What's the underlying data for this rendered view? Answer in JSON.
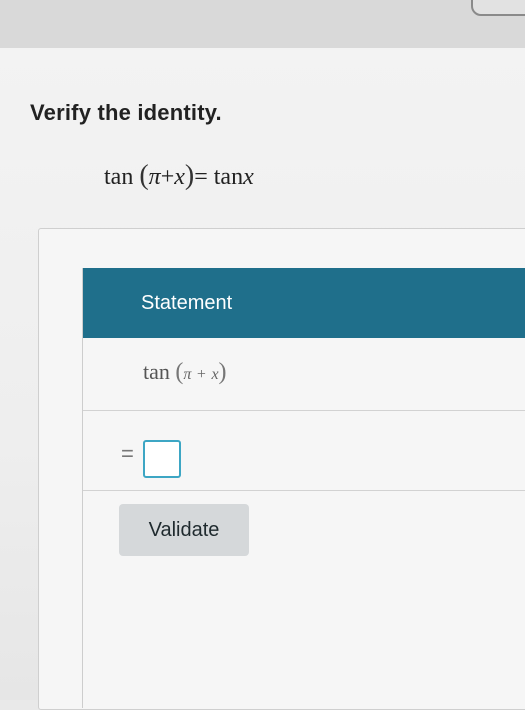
{
  "instruction": "Verify the identity.",
  "identity": {
    "lhs_func": "tan",
    "lhs_arg_left": "π",
    "lhs_arg_op": "+",
    "lhs_arg_right": "x",
    "equals": "=",
    "rhs_func": "tan",
    "rhs_var": "x"
  },
  "table": {
    "header_label": "Statement",
    "row1": {
      "func": "tan",
      "arg_left": "π",
      "arg_op": "+",
      "arg_right": "x"
    },
    "row2": {
      "equals": "=",
      "answer_value": ""
    }
  },
  "buttons": {
    "validate_label": "Validate"
  },
  "colors": {
    "header_bg": "#1f6f8b",
    "answer_border": "#3da6c4"
  }
}
